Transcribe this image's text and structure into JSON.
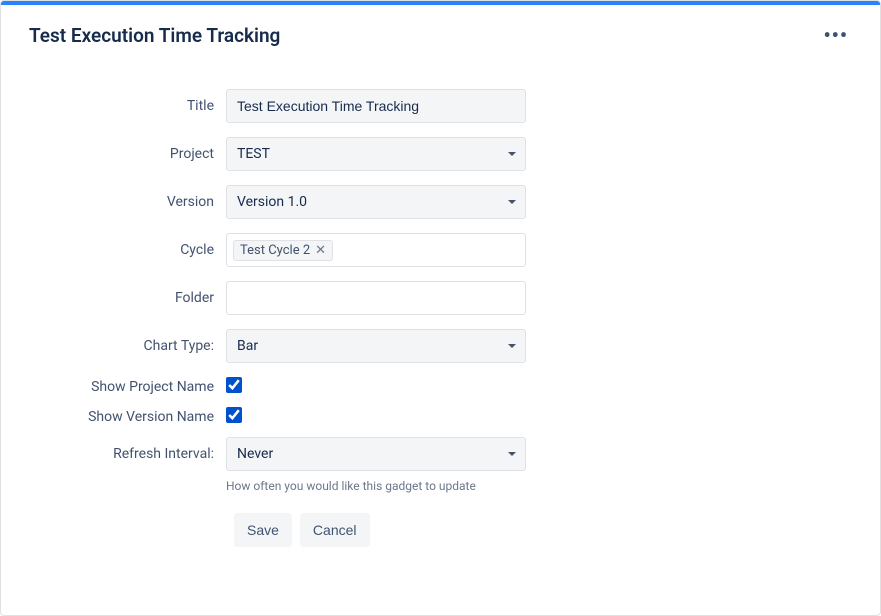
{
  "header": {
    "title": "Test Execution Time Tracking"
  },
  "form": {
    "title": {
      "label": "Title",
      "value": "Test Execution Time Tracking"
    },
    "project": {
      "label": "Project",
      "value": "TEST"
    },
    "version": {
      "label": "Version",
      "value": "Version 1.0"
    },
    "cycle": {
      "label": "Cycle",
      "tag": "Test Cycle 2"
    },
    "folder": {
      "label": "Folder",
      "value": ""
    },
    "chartType": {
      "label": "Chart Type:",
      "value": "Bar"
    },
    "showProjectName": {
      "label": "Show Project Name",
      "checked": true
    },
    "showVersionName": {
      "label": "Show Version Name",
      "checked": true
    },
    "refreshInterval": {
      "label": "Refresh Interval:",
      "value": "Never",
      "help": "How often you would like this gadget to update"
    },
    "buttons": {
      "save": "Save",
      "cancel": "Cancel"
    }
  }
}
